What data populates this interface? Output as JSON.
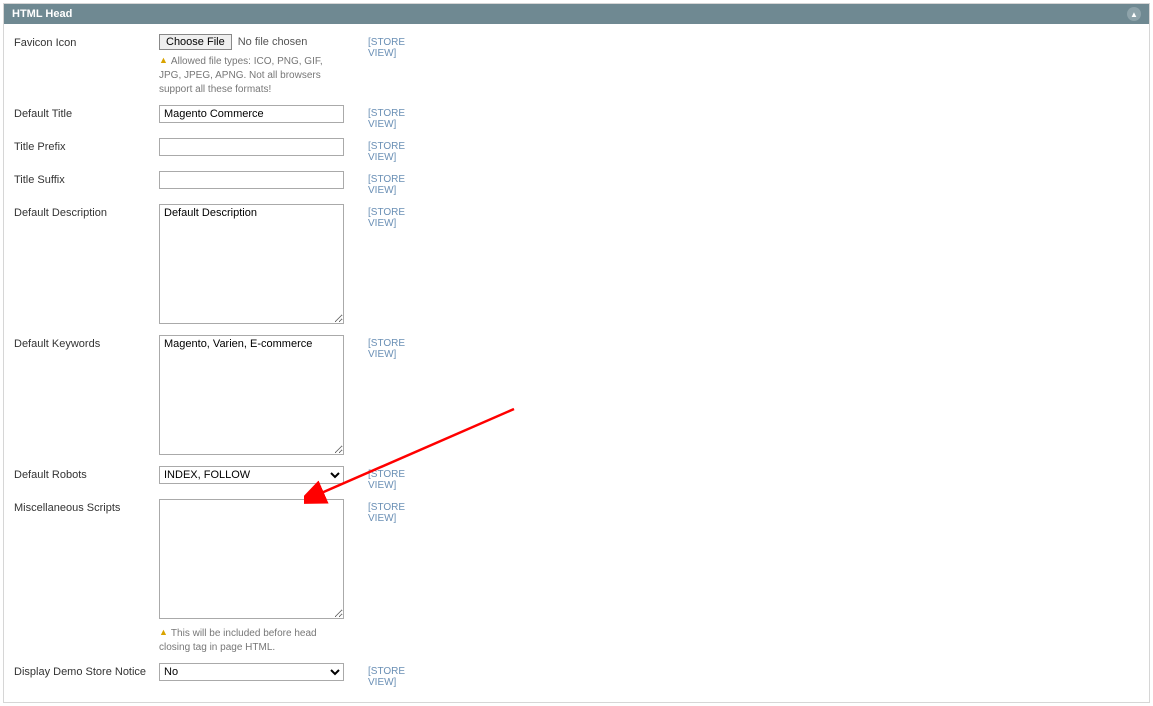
{
  "panel": {
    "title": "HTML Head"
  },
  "scope": "[STORE VIEW]",
  "favicon": {
    "label": "Favicon Icon",
    "button": "Choose File",
    "status": "No file chosen",
    "hint": "Allowed file types: ICO, PNG, GIF, JPG, JPEG, APNG. Not all browsers support all these formats!"
  },
  "defaultTitle": {
    "label": "Default Title",
    "value": "Magento Commerce"
  },
  "titlePrefix": {
    "label": "Title Prefix",
    "value": ""
  },
  "titleSuffix": {
    "label": "Title Suffix",
    "value": ""
  },
  "defaultDescription": {
    "label": "Default Description",
    "value": "Default Description"
  },
  "defaultKeywords": {
    "label": "Default Keywords",
    "value": "Magento, Varien, E-commerce"
  },
  "defaultRobots": {
    "label": "Default Robots",
    "value": "INDEX, FOLLOW"
  },
  "miscScripts": {
    "label": "Miscellaneous Scripts",
    "value": "",
    "hint": "This will be included before head closing tag in page HTML."
  },
  "demoNotice": {
    "label": "Display Demo Store Notice",
    "value": "No"
  }
}
